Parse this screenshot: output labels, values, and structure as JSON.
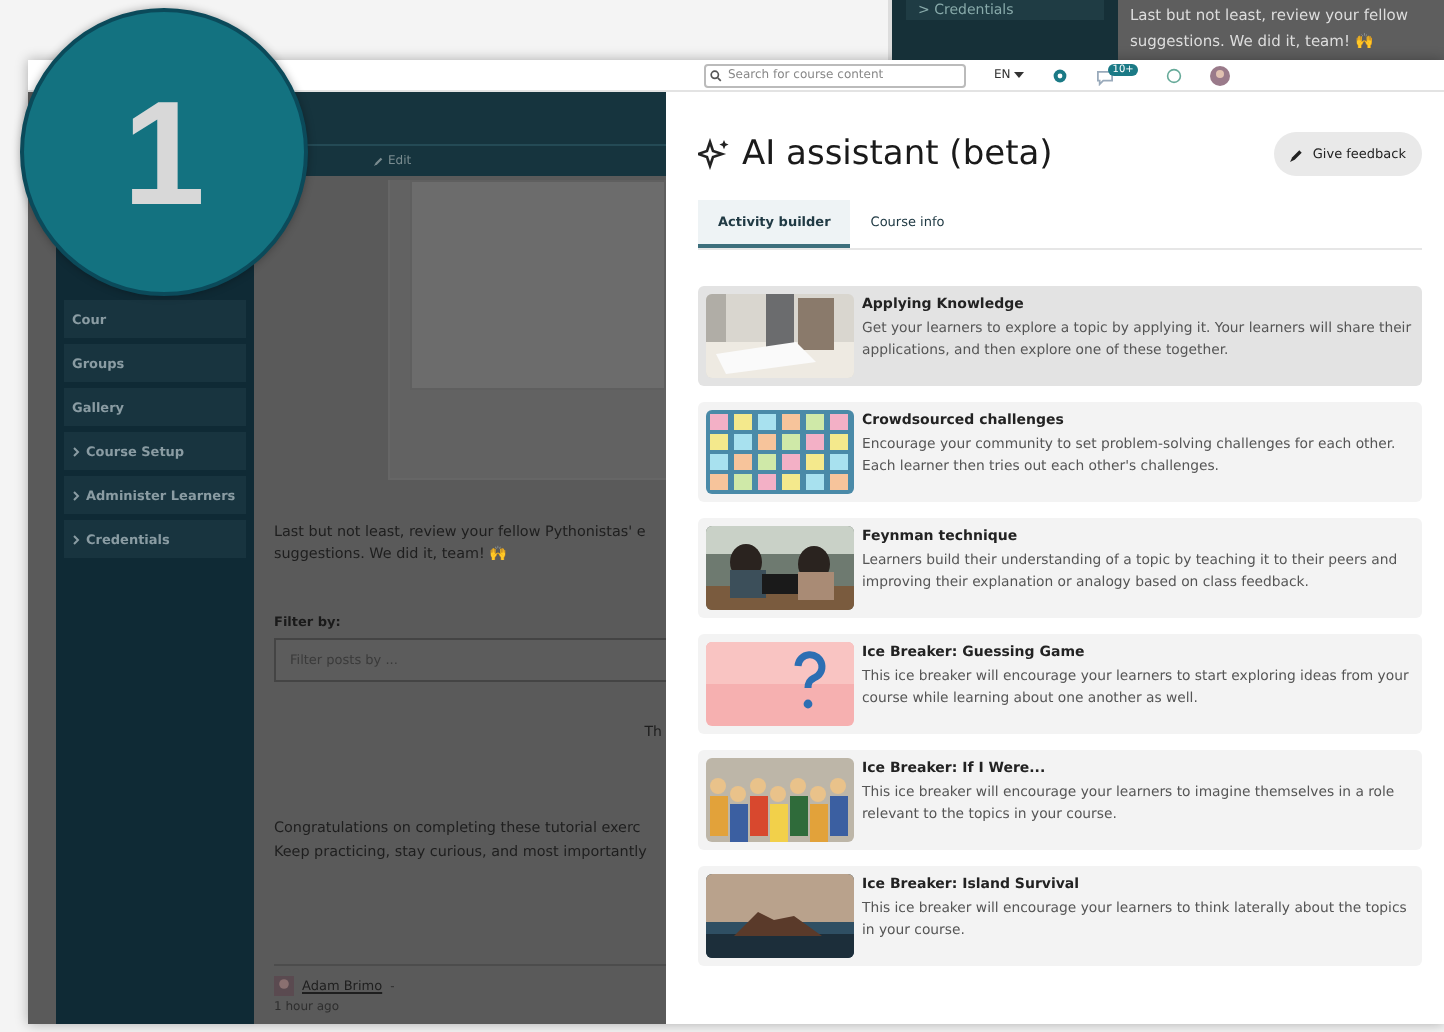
{
  "step_badge": "1",
  "background_screen": {
    "sidebar_item": "> Credentials",
    "text": [
      "Last but not least, review your fellow",
      "suggestions. We did it, team! 🙌"
    ]
  },
  "top_bar": {
    "search": {
      "placeholder": "Search for course content"
    },
    "language": "EN",
    "notification_count": "10+"
  },
  "course_page": {
    "sidebar": [
      {
        "label": "Cour",
        "kind": "plain"
      },
      {
        "label": "Groups",
        "kind": "plain"
      },
      {
        "label": "Gallery",
        "kind": "plain"
      },
      {
        "label": "Course Setup",
        "kind": "folder"
      },
      {
        "label": "Administer Learners",
        "kind": "folder"
      },
      {
        "label": "Credentials",
        "kind": "folder"
      }
    ],
    "edit": "Edit",
    "paragraph": [
      "Last but not least, review your fellow Pythonistas' e",
      "suggestions. We did it, team! 🙌"
    ],
    "filter": {
      "label": "Filter by:",
      "placeholder": "Filter posts by ..."
    },
    "cut_text": "Th",
    "closing": [
      "Congratulations on completing these tutorial exerc",
      "Keep practicing, stay curious, and most importantly"
    ],
    "post": {
      "author": "Adam Brimo",
      "separator": "-",
      "time": "1 hour ago"
    }
  },
  "assistant": {
    "title": "AI assistant (beta)",
    "feedback": "Give feedback",
    "tabs": [
      {
        "label": "Activity builder",
        "selected": true
      },
      {
        "label": "Course info",
        "selected": false
      }
    ],
    "activities": [
      {
        "title": "Applying Knowledge",
        "text": "Get your learners to explore a topic by applying it. Your learners will share their applications, and then explore one of these together.",
        "selected": true,
        "kind": "picture"
      },
      {
        "title": "Crowdsourced challenges",
        "text": "Encourage your community to set problem-solving challenges for each other. Each learner then tries out each other's challenges.",
        "selected": false,
        "kind": "picture"
      },
      {
        "title": "Feynman technique",
        "text": "Learners build their understanding of a topic by teaching it to their peers and improving their explanation or analogy based on class feedback.",
        "selected": false,
        "kind": "picture"
      },
      {
        "title": "Ice Breaker: Guessing Game",
        "text": "This ice breaker will encourage your learners to start exploring ideas from your course while learning about one another as well.",
        "selected": false,
        "kind": "question"
      },
      {
        "title": "Ice Breaker: If I Were...",
        "text": "This ice breaker will encourage your learners to imagine themselves in a role relevant to the topics in your course.",
        "selected": false,
        "kind": "picture"
      },
      {
        "title": "Ice Breaker: Island Survival",
        "text": "This ice breaker will encourage your learners to think laterally about the topics in your course.",
        "selected": false,
        "kind": "picture"
      }
    ]
  }
}
